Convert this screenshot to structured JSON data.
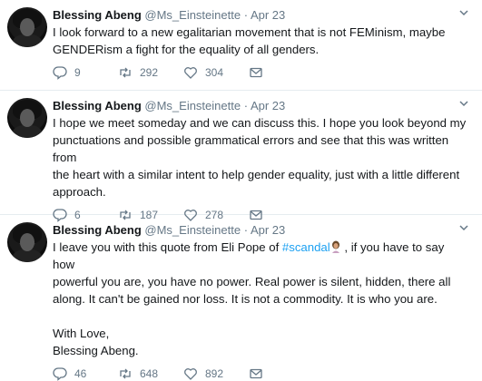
{
  "tweets": [
    {
      "name": "Blessing Abeng",
      "handle": "@Ms_Einsteinette",
      "separator": "·",
      "date": "Apr 23",
      "text_lines": [
        "I look forward to a new egalitarian movement that is not FEMinism, maybe",
        "GENDERism a fight for the equality of all genders."
      ],
      "replies": "9",
      "retweets": "292",
      "likes": "304"
    },
    {
      "name": "Blessing Abeng",
      "handle": "@Ms_Einsteinette",
      "separator": "·",
      "date": "Apr 23",
      "text_lines": [
        "I hope we meet someday and we can discuss this. I hope you look beyond my",
        "punctuations and possible grammatical errors and see that this was written from",
        "the heart with a similar intent to help gender equality, just with a little different",
        "approach."
      ],
      "replies": "6",
      "retweets": "187",
      "likes": "278"
    },
    {
      "name": "Blessing Abeng",
      "handle": "@Ms_Einsteinette",
      "separator": "·",
      "date": "Apr 23",
      "line1_pre": "I leave you with this quote from Eli Pope of ",
      "hashtag": "#scandal",
      "line1_post": " , if you have to say how",
      "text_lines_rest": [
        "powerful you are, you have no power. Real power is silent, hidden, there all",
        "along. It can't be gained nor loss. It is not a commodity. It is who you are."
      ],
      "signoff": [
        "With Love,",
        "Blessing Abeng."
      ],
      "replies": "46",
      "retweets": "648",
      "likes": "892"
    }
  ],
  "icons": {
    "more": "chevron-down-icon",
    "reply": "reply-icon",
    "retweet": "retweet-icon",
    "like": "heart-icon",
    "dm": "mail-icon"
  },
  "colors": {
    "hashtag": "#1da1f2",
    "secondary_text": "#657786",
    "divider": "#e6ecf0"
  }
}
